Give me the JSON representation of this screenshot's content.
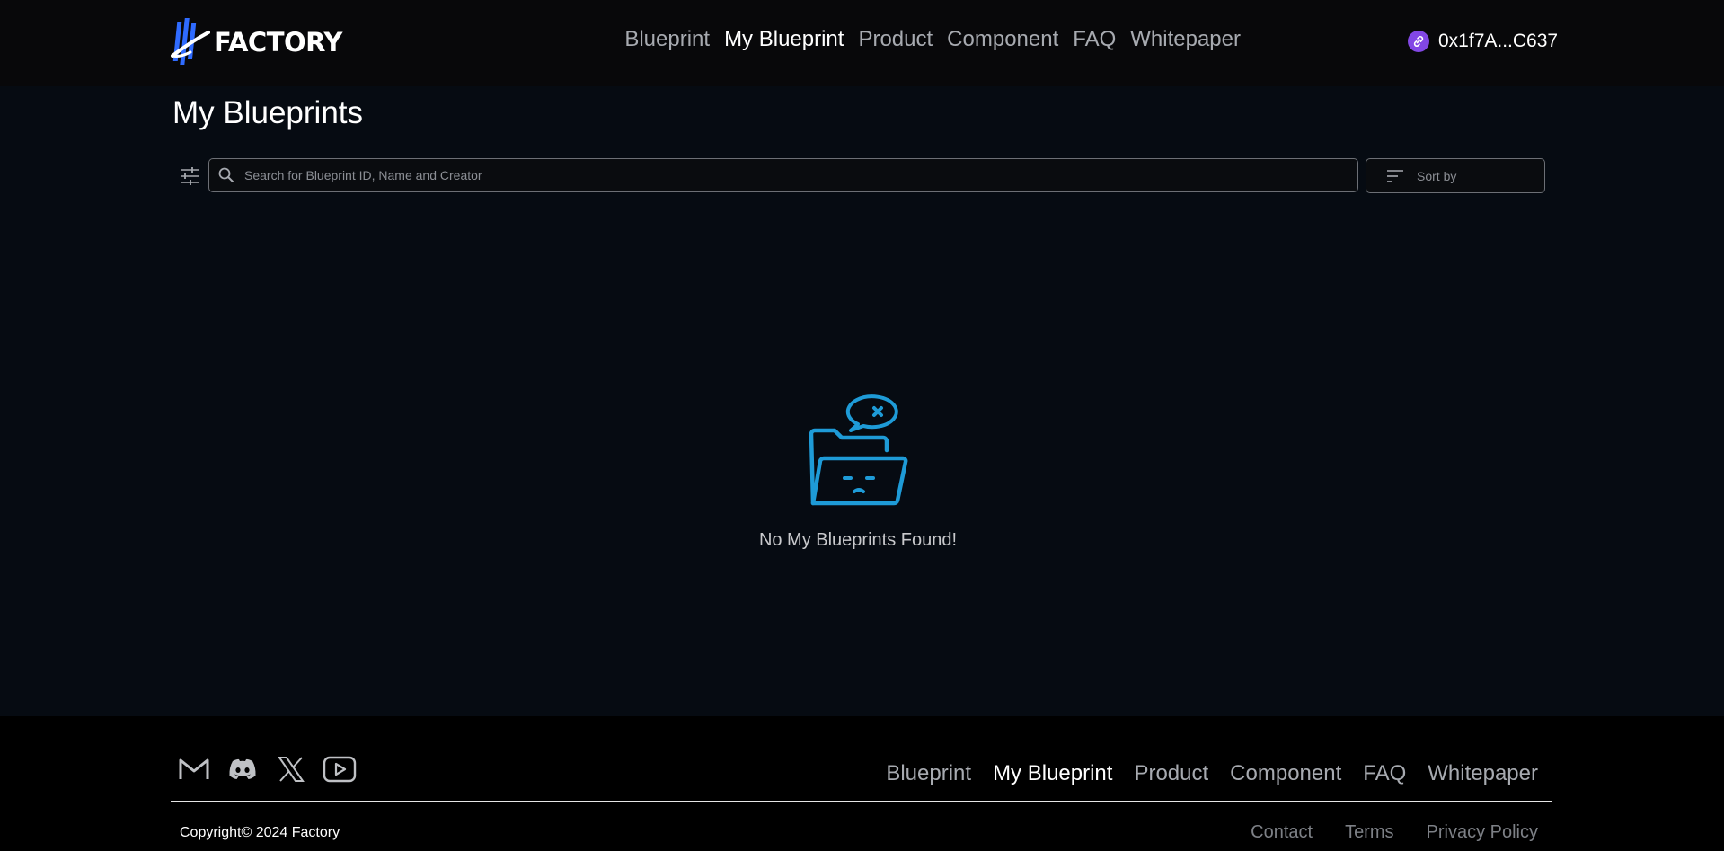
{
  "header": {
    "logo_text": "FACTORY",
    "nav": [
      {
        "label": "Blueprint",
        "active": false
      },
      {
        "label": "My Blueprint",
        "active": true
      },
      {
        "label": "Product",
        "active": false
      },
      {
        "label": "Component",
        "active": false
      },
      {
        "label": "FAQ",
        "active": false
      },
      {
        "label": "Whitepaper",
        "active": false
      }
    ],
    "wallet": {
      "address": "0x1f7A...C637",
      "icon": "polygon-link-icon",
      "icon_color": "#8247e5"
    }
  },
  "main": {
    "title": "My Blueprints",
    "search": {
      "placeholder": "Search for Blueprint ID, Name and Creator",
      "value": ""
    },
    "sort": {
      "label": "Sort by"
    },
    "empty_state": {
      "message": "No My Blueprints Found!",
      "icon": "sad-folder-icon",
      "icon_color": "#1e9bd7"
    }
  },
  "footer": {
    "social": [
      "gmail-icon",
      "discord-icon",
      "x-icon",
      "youtube-icon"
    ],
    "nav": [
      {
        "label": "Blueprint",
        "active": false
      },
      {
        "label": "My Blueprint",
        "active": true
      },
      {
        "label": "Product",
        "active": false
      },
      {
        "label": "Component",
        "active": false
      },
      {
        "label": "FAQ",
        "active": false
      },
      {
        "label": "Whitepaper",
        "active": false
      }
    ],
    "copyright": "Copyright© 2024 Factory",
    "legal": [
      {
        "label": "Contact"
      },
      {
        "label": "Terms"
      },
      {
        "label": "Privacy Policy"
      }
    ]
  },
  "colors": {
    "background": "#060b12",
    "header": "#08080a",
    "footer": "#000000",
    "accent": "#1e9bd7",
    "logo_blue": "#2f6bff"
  }
}
